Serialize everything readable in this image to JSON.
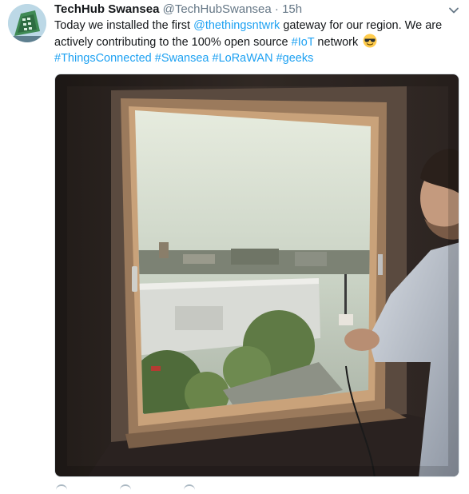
{
  "tweet": {
    "author_name": "TechHub Swansea",
    "handle": "@TechHubSwansea",
    "separator": "·",
    "time": "15h",
    "text_prefix": "Today we installed the first ",
    "mention": "@thethingsntwrk",
    "text_middle": " gateway for our region. We are actively contributing to the 100% open source ",
    "hashtag_inline": "#IoT",
    "text_suffix": " network",
    "emoji": "smiling-face-with-sunglasses",
    "hashtags": [
      "#ThingsConnected",
      "#Swansea",
      "#LoRaWAN",
      "#geeks"
    ]
  },
  "colors": {
    "link": "#1da1f2",
    "secondary_text": "#657786",
    "primary_text": "#14171a"
  },
  "icons": {
    "avatar": "techhub-swansea-avatar",
    "menu": "chevron-down-icon",
    "photo": "window-gateway-photo"
  }
}
